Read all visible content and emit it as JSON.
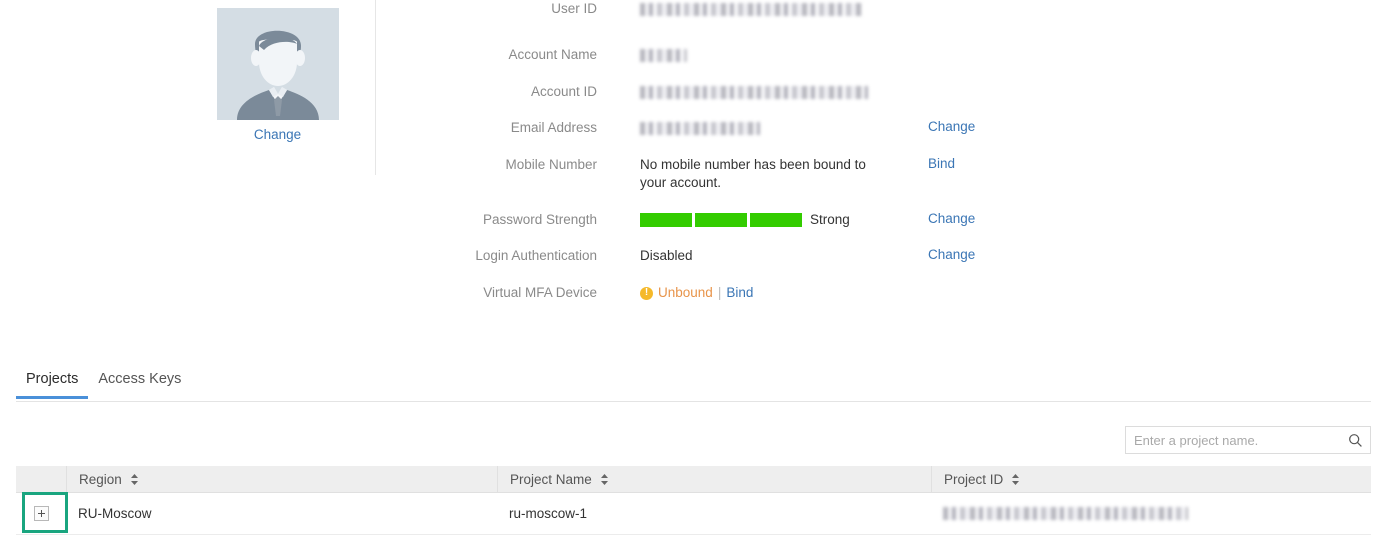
{
  "avatar": {
    "change_label": "Change",
    "icon": "user-avatar-icon",
    "bg_color": "#d4dde4"
  },
  "fields": [
    {
      "label": "User ID",
      "value": "",
      "redacted": true,
      "redacted_width": 222,
      "action": ""
    },
    {
      "label": "Account Name",
      "value": "",
      "redacted": true,
      "redacted_width": 47,
      "action": ""
    },
    {
      "label": "Account ID",
      "value": "",
      "redacted": true,
      "redacted_width": 228,
      "action": ""
    },
    {
      "label": "Email Address",
      "value": "",
      "redacted": true,
      "redacted_width": 120,
      "action": "Change"
    },
    {
      "label": "Mobile Number",
      "value": "No mobile number has been bound to your account.",
      "redacted": false,
      "action": "Bind"
    },
    {
      "label": "Password Strength",
      "value": "Strong",
      "redacted": false,
      "action": "Change"
    },
    {
      "label": "Login Authentication",
      "value": "Disabled",
      "redacted": false,
      "action": "Change"
    },
    {
      "label": "Virtual MFA Device",
      "value": "Unbound",
      "redacted": false,
      "action": ""
    }
  ],
  "password_strength": {
    "segments": 3,
    "filled_color": "#33cc00",
    "text": "Strong"
  },
  "mfa": {
    "icon": "warning-circle-icon",
    "status": "Unbound",
    "separator": "|",
    "bind_label": "Bind",
    "status_color": "#e8944a",
    "warn_color": "#f5b92a"
  },
  "tabs": [
    {
      "label": "Projects",
      "active": true
    },
    {
      "label": "Access Keys",
      "active": false
    }
  ],
  "search": {
    "placeholder": "Enter a project name.",
    "value": "",
    "icon": "search-icon"
  },
  "table": {
    "columns": [
      {
        "key": "expand",
        "label": "",
        "sortable": false
      },
      {
        "key": "region",
        "label": "Region",
        "sortable": true
      },
      {
        "key": "project_name",
        "label": "Project Name",
        "sortable": true
      },
      {
        "key": "project_id",
        "label": "Project ID",
        "sortable": true
      }
    ],
    "rows": [
      {
        "expand_icon": "expand-plus-icon",
        "region": "RU-Moscow",
        "project_name": "ru-moscow-1",
        "project_id": "",
        "project_id_redacted": true,
        "project_id_redacted_width": 245
      }
    ]
  },
  "highlight": {
    "color": "#19a57f",
    "target": "expand-row-button"
  }
}
